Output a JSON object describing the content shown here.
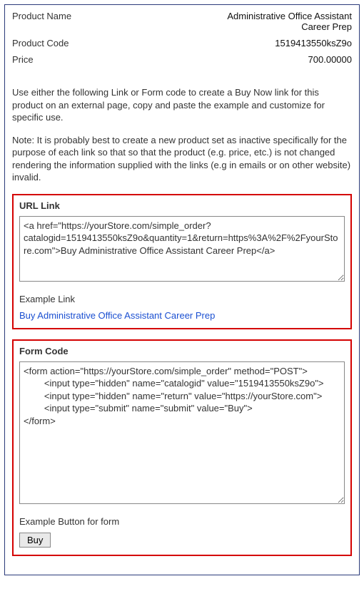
{
  "meta": {
    "productName_label": "Product Name",
    "productName_value": "Administrative Office Assistant Career Prep",
    "productCode_label": "Product Code",
    "productCode_value": "1519413550ksZ9o",
    "price_label": "Price",
    "price_value": "700.00000"
  },
  "instructions": "Use either the following Link or Form code to create a Buy Now link for this product on an external page, copy and paste the example and customize for specific use.",
  "note": "Note: It is probably best to create a new product set as inactive specifically for the purpose of each link so that so that the product (e.g. price, etc.) is not changed rendering the information supplied with the links (e.g in emails or on other website) invalid.",
  "url_section": {
    "heading": "URL Link",
    "code": "<a href=\"https://yourStore.com/simple_order?catalogid=1519413550ksZ9o&quantity=1&return=https%3A%2F%2FyourStore.com\">Buy Administrative Office Assistant Career Prep</a>",
    "example_label": "Example Link",
    "example_link_text": "Buy Administrative Office Assistant Career Prep"
  },
  "form_section": {
    "heading": "Form Code",
    "code": "<form action=\"https://yourStore.com/simple_order\" method=\"POST\">\n        <input type=\"hidden\" name=\"catalogid\" value=\"1519413550ksZ9o\">\n        <input type=\"hidden\" name=\"return\" value=\"https://yourStore.com\">\n        <input type=\"submit\" name=\"submit\" value=\"Buy\">\n</form>",
    "example_label": "Example Button for form",
    "buy_label": "Buy"
  }
}
